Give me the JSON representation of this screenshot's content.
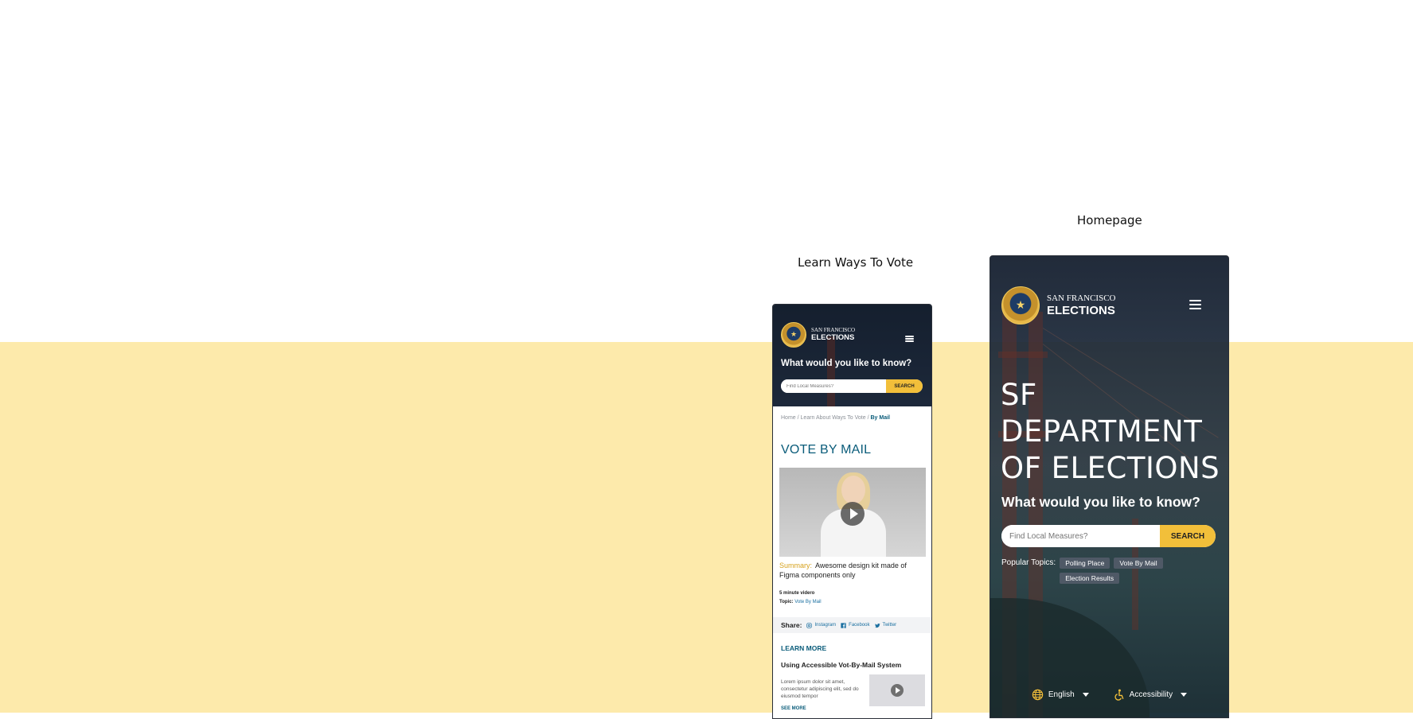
{
  "labels": {
    "frame1": "Learn Ways To Vote",
    "frame2": "Homepage"
  },
  "logo": {
    "top": "SAN FRANCISCO",
    "bottom": "ELECTIONS"
  },
  "small": {
    "question": "What would you like to know?",
    "search_placeholder": "Find Local Measures?",
    "search_button": "SEARCH",
    "breadcrumb": {
      "home": "Home",
      "sep1": " / ",
      "learn": "Learn About Ways To Vote",
      "sep2": " / ",
      "current": "By Mail"
    },
    "title": "VOTE BY MAIL",
    "summary_label": "Summary:",
    "summary_text": "Awesome design kit made of Figma components only",
    "meta_length": "5 minute videro",
    "meta_topic_label": "Topic:",
    "meta_topic_value": "Vote By Mail",
    "share_label": "Share:",
    "share": {
      "instagram": "Instagram",
      "facebook": "Facebook",
      "twitter": "Twitter"
    },
    "learn_more": "LEARN MORE",
    "article_title": "Using Accessible Vot-By-Mail System",
    "article_body": "Lorem ipsum dolor sit amet, consectetur adipiscing elit, sed do eiusmod tempor",
    "see_more": "SEE MORE"
  },
  "large": {
    "hero_line1": "SF",
    "hero_line2": "DEPARTMENT",
    "hero_line3": "OF ELECTIONS",
    "question": "What would you like to know?",
    "search_placeholder": "Find Local Measures?",
    "search_button": "SEARCH",
    "topics_label": "Popular Topics:",
    "topics": [
      "Polling Place",
      "Vote By Mail",
      "Election Results"
    ],
    "language": "English",
    "accessibility": "Accessibility"
  },
  "colors": {
    "accent_yellow": "#f2bf3a",
    "brand_teal": "#0a5c7a",
    "header_navy": "#1f2b3c",
    "backdrop_yellow": "#fdeaab"
  },
  "icons": {
    "menu": "hamburger-icon",
    "play": "play-icon",
    "globe": "globe-icon",
    "accessibility": "wheelchair-icon",
    "instagram": "instagram-icon",
    "facebook": "facebook-icon",
    "twitter": "twitter-icon"
  }
}
